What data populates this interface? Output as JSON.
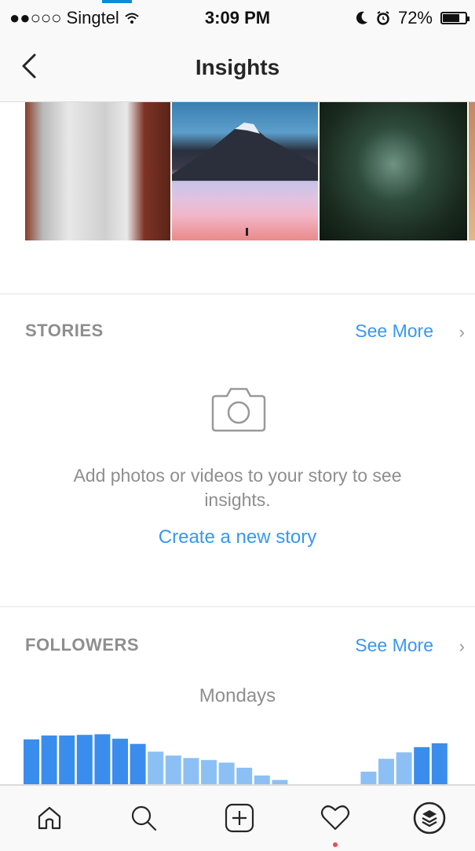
{
  "status_bar": {
    "carrier": "●●○○○ Singtel",
    "time": "3:09 PM",
    "battery": "72%",
    "icons": [
      "wifi-icon",
      "moon-icon",
      "alarm-icon",
      "battery-icon"
    ]
  },
  "nav": {
    "title": "Insights",
    "back_icon": "chevron-left-icon"
  },
  "photos": [
    "bridge-photo",
    "mountain-photo",
    "forest-photo"
  ],
  "stories": {
    "title": "STORIES",
    "see_more": "See More",
    "message": "Add photos or videos to your story to see insights.",
    "create_link": "Create a new story"
  },
  "followers": {
    "title": "FOLLOWERS",
    "see_more": "See More",
    "chart_title": "Mondays"
  },
  "chart_data": {
    "type": "bar",
    "title": "Mondays",
    "values": [
      72,
      78,
      78,
      79,
      80,
      73,
      65,
      53,
      47,
      43,
      40,
      36,
      28,
      16,
      9,
      0,
      0,
      0,
      0,
      22,
      42,
      52,
      60,
      66
    ],
    "colors": {
      "bar_dark": "#3b8ded",
      "bar_light": "#8cc0f5"
    },
    "grid": false
  },
  "tab_bar": {
    "icons": [
      "home-icon",
      "search-icon",
      "add-post-icon",
      "activity-heart-icon",
      "profile-stack-icon"
    ]
  },
  "colors": {
    "accent": "#3897f0",
    "muted_text": "#8e8e8e",
    "notification_dot": "#ed4956"
  }
}
